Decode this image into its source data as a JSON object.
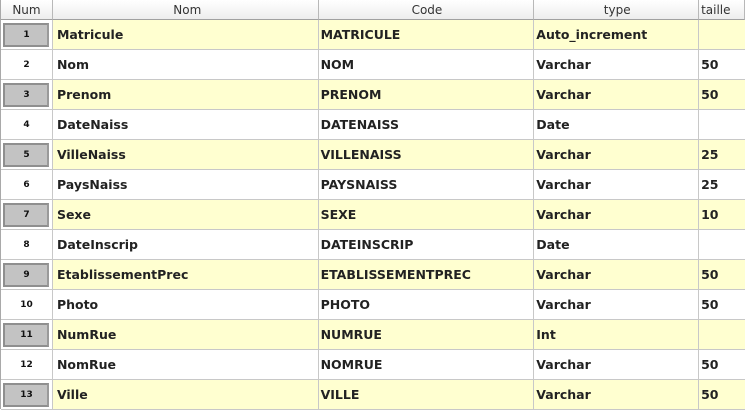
{
  "columns": {
    "num": "Num",
    "nom": "Nom",
    "code": "Code",
    "type": "type",
    "taille": "taille"
  },
  "rows": [
    {
      "num": "1",
      "nom": "Matricule",
      "code": "MATRICULE",
      "type": "Auto_increment",
      "taille": ""
    },
    {
      "num": "2",
      "nom": "Nom",
      "code": "NOM",
      "type": "Varchar",
      "taille": "50"
    },
    {
      "num": "3",
      "nom": "Prenom",
      "code": "PRENOM",
      "type": "Varchar",
      "taille": "50"
    },
    {
      "num": "4",
      "nom": "DateNaiss",
      "code": "DATENAISS",
      "type": "Date",
      "taille": ""
    },
    {
      "num": "5",
      "nom": "VilleNaiss",
      "code": "VILLENAISS",
      "type": "Varchar",
      "taille": "25"
    },
    {
      "num": "6",
      "nom": "PaysNaiss",
      "code": "PAYSNAISS",
      "type": "Varchar",
      "taille": "25"
    },
    {
      "num": "7",
      "nom": "Sexe",
      "code": "SEXE",
      "type": "Varchar",
      "taille": "10"
    },
    {
      "num": "8",
      "nom": "DateInscrip",
      "code": "DATEINSCRIP",
      "type": "Date",
      "taille": ""
    },
    {
      "num": "9",
      "nom": "EtablissementPrec",
      "code": "ETABLISSEMENTPREC",
      "type": "Varchar",
      "taille": "50"
    },
    {
      "num": "10",
      "nom": "Photo",
      "code": "PHOTO",
      "type": "Varchar",
      "taille": "50"
    },
    {
      "num": "11",
      "nom": "NumRue",
      "code": "NUMRUE",
      "type": "Int",
      "taille": ""
    },
    {
      "num": "12",
      "nom": "NomRue",
      "code": "NOMRUE",
      "type": "Varchar",
      "taille": "50"
    },
    {
      "num": "13",
      "nom": "Ville",
      "code": "VILLE",
      "type": "Varchar",
      "taille": "50"
    }
  ],
  "colors": {
    "highlight_row": "#ffffd0",
    "plain_row": "#ffffff",
    "row_header_selected": "#c3c3c3"
  }
}
